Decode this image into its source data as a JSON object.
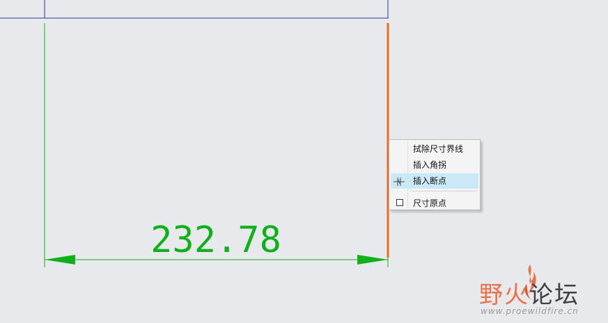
{
  "dimension": {
    "value_text": "232.78"
  },
  "context_menu": {
    "items": [
      {
        "label": "拭除尺寸界线",
        "icon": "none"
      },
      {
        "label": "插入角拐",
        "icon": "none"
      },
      {
        "label": "插入断点",
        "icon": "insert-break-icon",
        "highlighted": true
      },
      {
        "label": "尺寸原点",
        "icon": "checkbox-icon",
        "checked": false
      }
    ]
  },
  "watermark": {
    "title_part1": "野火",
    "title_part2": "论坛",
    "url": "www.proewildfire.cn"
  },
  "colors": {
    "background": "#e8e9ed",
    "dimension_green": "#10b01a",
    "selected_orange": "#f06a1e",
    "geometry_blue": "#2b3a8a",
    "menu_highlight": "#cbe8f6"
  }
}
